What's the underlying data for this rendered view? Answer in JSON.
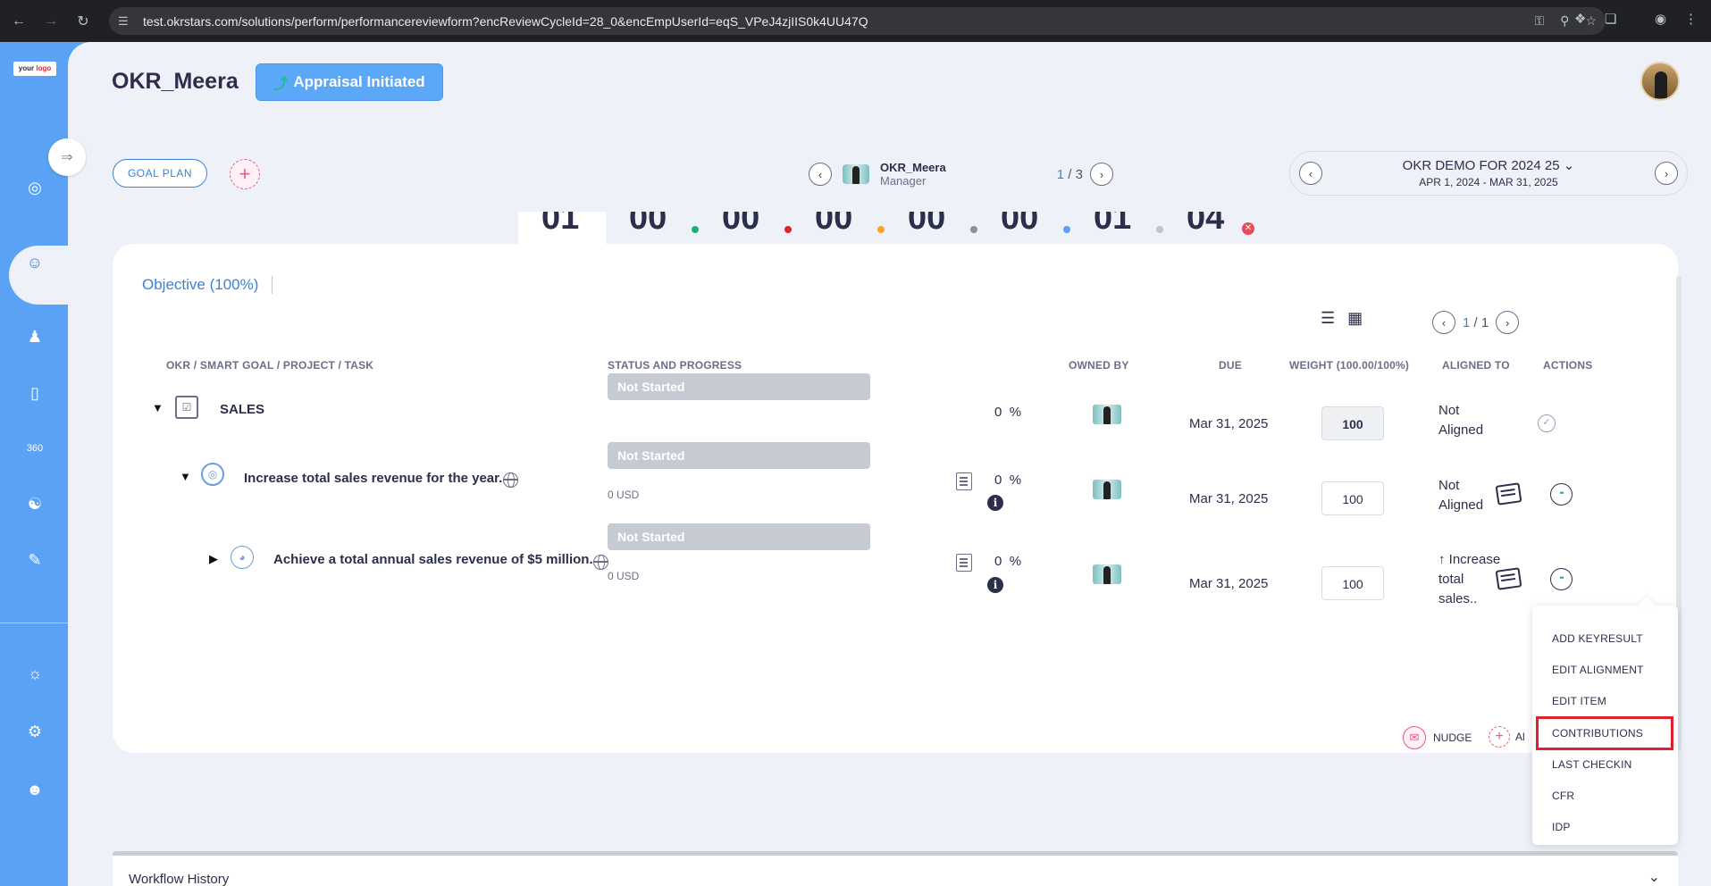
{
  "browser": {
    "url": "test.okrstars.com/solutions/perform/performancereviewform?encReviewCycleId=28_0&encEmpUserId=eqS_VPeJ4zjIIS0k4UU47Q"
  },
  "sidebar": {
    "logo_a": "your",
    "logo_b": "logo"
  },
  "header": {
    "title": "OKR_Meera",
    "appraisal_label": "Appraisal Initiated"
  },
  "toolbar": {
    "goal_plan_label": "GOAL PLAN",
    "add_symbol": "+"
  },
  "employee_nav": {
    "name": "OKR_Meera",
    "role": "Manager",
    "current": "1",
    "separator": "/",
    "total": "3"
  },
  "cycle": {
    "title": "OKR DEMO FOR 2024 25",
    "dates": "APR 1, 2024 - MAR 31, 2025"
  },
  "stats": [
    "01",
    "00",
    "00",
    "00",
    "00",
    "00",
    "01",
    "04"
  ],
  "colors": {
    "accent": "#5aa2f5",
    "dot_green": "#19b46e",
    "dot_red": "#e02030",
    "dot_orange": "#f5a623",
    "dot_gray": "#8a8f9c",
    "dot_blue": "#5aa2f5",
    "dot_lightgray": "#c0c4cc",
    "highlight": "#e0202a"
  },
  "objective_tab": {
    "label": "Objective (100%)"
  },
  "card_pager": {
    "current": "1",
    "separator": "/",
    "total": "1"
  },
  "columns": {
    "okr": "OKR / SMART GOAL / PROJECT / TASK",
    "status": "STATUS AND PROGRESS",
    "owned": "OWNED BY",
    "due": "DUE",
    "weight": "WEIGHT (100.00/100%)",
    "aligned": "ALIGNED TO",
    "actions": "ACTIONS"
  },
  "rows": [
    {
      "title": "SALES",
      "status": "Not Started",
      "progress": "0",
      "pct_sign": "%",
      "usd": "",
      "due": "Mar 31, 2025",
      "weight": "100",
      "aligned_a": "Not",
      "aligned_b": "Aligned",
      "aligned_c": ""
    },
    {
      "title": "Increase total sales revenue for the year.",
      "status": "Not Started",
      "progress": "0",
      "pct_sign": "%",
      "usd": "0 USD",
      "due": "Mar 31, 2025",
      "weight": "100",
      "aligned_a": "Not",
      "aligned_b": "Aligned",
      "aligned_c": ""
    },
    {
      "title": "Achieve a total annual sales revenue of $5 million.",
      "status": "Not Started",
      "progress": "0",
      "pct_sign": "%",
      "usd": "0 USD",
      "due": "Mar 31, 2025",
      "weight": "100",
      "aligned_a": "↑ Increase",
      "aligned_b": "total",
      "aligned_c": "sales.."
    }
  ],
  "footer_actions": {
    "nudge": "NUDGE",
    "add": "Al"
  },
  "menu": {
    "items": [
      "ADD KEYRESULT",
      "EDIT ALIGNMENT",
      "EDIT ITEM",
      "CONTRIBUTIONS",
      "LAST CHECKIN",
      "CFR",
      "IDP"
    ]
  },
  "workflow": {
    "title": "Workflow History"
  },
  "icons": {
    "back": "arrow-left-icon",
    "forward": "arrow-right-icon",
    "reload": "reload-icon",
    "collapse": "collapse-icon",
    "target": "target-icon",
    "team": "team-icon",
    "person": "person-icon",
    "book": "book-icon",
    "review": "360-icon",
    "hierarchy": "hierarchy-icon",
    "report": "report-icon",
    "support": "support-icon",
    "settings": "gear-icon",
    "user": "user-icon"
  }
}
